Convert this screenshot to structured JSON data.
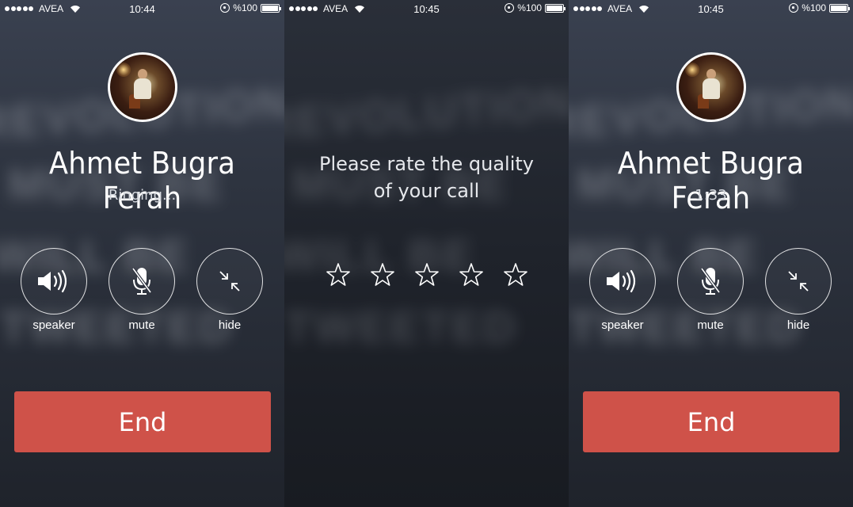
{
  "screens": [
    {
      "status_bar": {
        "carrier": "AVEA",
        "time": "10:44",
        "battery": "%100"
      },
      "contact_name": "Ahmet Bugra Ferah",
      "call_status": "Ringing...",
      "controls": {
        "speaker": "speaker",
        "mute": "mute",
        "hide": "hide"
      },
      "end_label": "End"
    },
    {
      "status_bar": {
        "carrier": "AVEA",
        "time": "10:45",
        "battery": "%100"
      },
      "rating_prompt_line1": "Please rate the quality",
      "rating_prompt_line2": "of your call",
      "star_count": 5,
      "star_glyph": "☆"
    },
    {
      "status_bar": {
        "carrier": "AVEA",
        "time": "10:45",
        "battery": "%100"
      },
      "contact_name": "Ahmet Bugra Ferah",
      "call_status": "1:33",
      "controls": {
        "speaker": "speaker",
        "mute": "mute",
        "hide": "hide"
      },
      "end_label": "End"
    }
  ],
  "background_text": [
    "REVOLUTION",
    "MUST BE",
    "WILL BE",
    "TWEETED"
  ],
  "colors": {
    "end_button": "#cf5249",
    "text": "#ffffff"
  }
}
